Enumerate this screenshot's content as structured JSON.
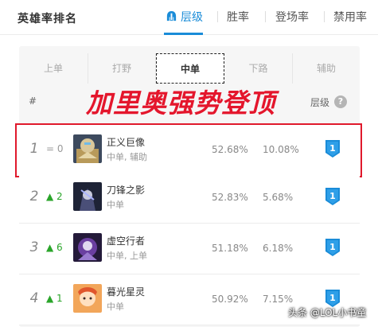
{
  "header": {
    "title": "英雄率排名",
    "tabs": [
      {
        "label": "层级",
        "active": true,
        "icon": "helmet-icon"
      },
      {
        "label": "胜率",
        "active": false
      },
      {
        "label": "登场率",
        "active": false
      },
      {
        "label": "禁用率",
        "active": false
      }
    ]
  },
  "positions": [
    {
      "label": "上单",
      "active": false
    },
    {
      "label": "打野",
      "active": false
    },
    {
      "label": "中单",
      "active": true
    },
    {
      "label": "下路",
      "active": false
    },
    {
      "label": "辅助",
      "active": false
    }
  ],
  "columns": {
    "rank": "#",
    "tier": "层级",
    "help": "?"
  },
  "overlay_text": "加里奥强势登顶",
  "rows": [
    {
      "rank": "1",
      "change": "= 0",
      "trend": "same",
      "name": "正义巨像",
      "roles": "中单, 辅助",
      "winrate": "52.68%",
      "pickrate": "10.08%",
      "tier": "1"
    },
    {
      "rank": "2",
      "change": "▲ 2",
      "trend": "up",
      "name": "刀锋之影",
      "roles": "中单",
      "winrate": "52.83%",
      "pickrate": "5.68%",
      "tier": "1"
    },
    {
      "rank": "3",
      "change": "▲ 6",
      "trend": "up",
      "name": "虚空行者",
      "roles": "中单, 上单",
      "winrate": "51.18%",
      "pickrate": "6.18%",
      "tier": "1"
    },
    {
      "rank": "4",
      "change": "▲ 1",
      "trend": "up",
      "name": "暮光星灵",
      "roles": "中单",
      "winrate": "50.92%",
      "pickrate": "7.15%",
      "tier": "1"
    }
  ],
  "watermark": "头条 @LOL小书童",
  "colors": {
    "accent": "#1a8cd8",
    "highlight_border": "#e0192c",
    "overlay": "#e4162c",
    "up": "#2aa52a"
  }
}
